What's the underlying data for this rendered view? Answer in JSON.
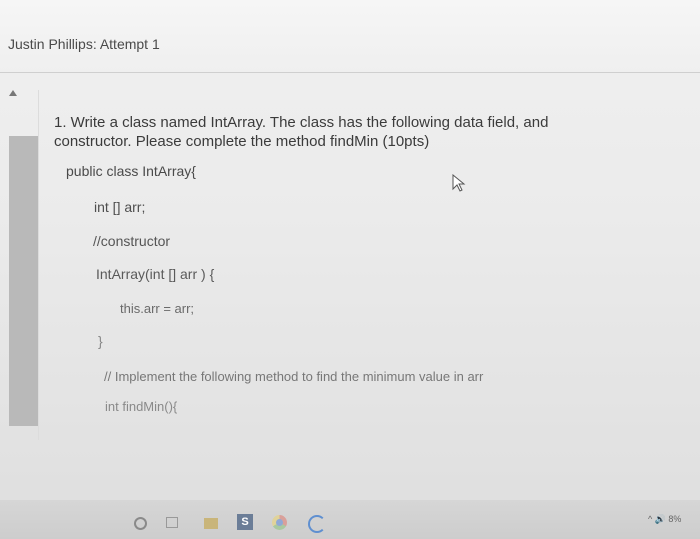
{
  "header": {
    "attempt_title": "Justin Phillips: Attempt 1"
  },
  "question": {
    "text": "1. Write a class named IntArray. The class has the following data field, and constructor. Please complete the method findMin (10pts)"
  },
  "code": {
    "line_class": "public class IntArray{",
    "line_field": "int [] arr;",
    "line_comment_ctor": "//constructor",
    "line_ctor": "IntArray(int [] arr ) {",
    "line_assign": "this.arr = arr;",
    "line_close": "}",
    "line_comment_method": "// Implement the following method to find the minimum value in arr",
    "line_method": "int findMin(){"
  },
  "taskbar": {
    "icons": [
      "search-icon",
      "task-view-icon",
      "file-explorer-icon",
      "app-icon",
      "chrome-icon",
      "edge-icon"
    ],
    "app_icon_letter": "S",
    "tray_text": "^ 🔊 8%"
  }
}
